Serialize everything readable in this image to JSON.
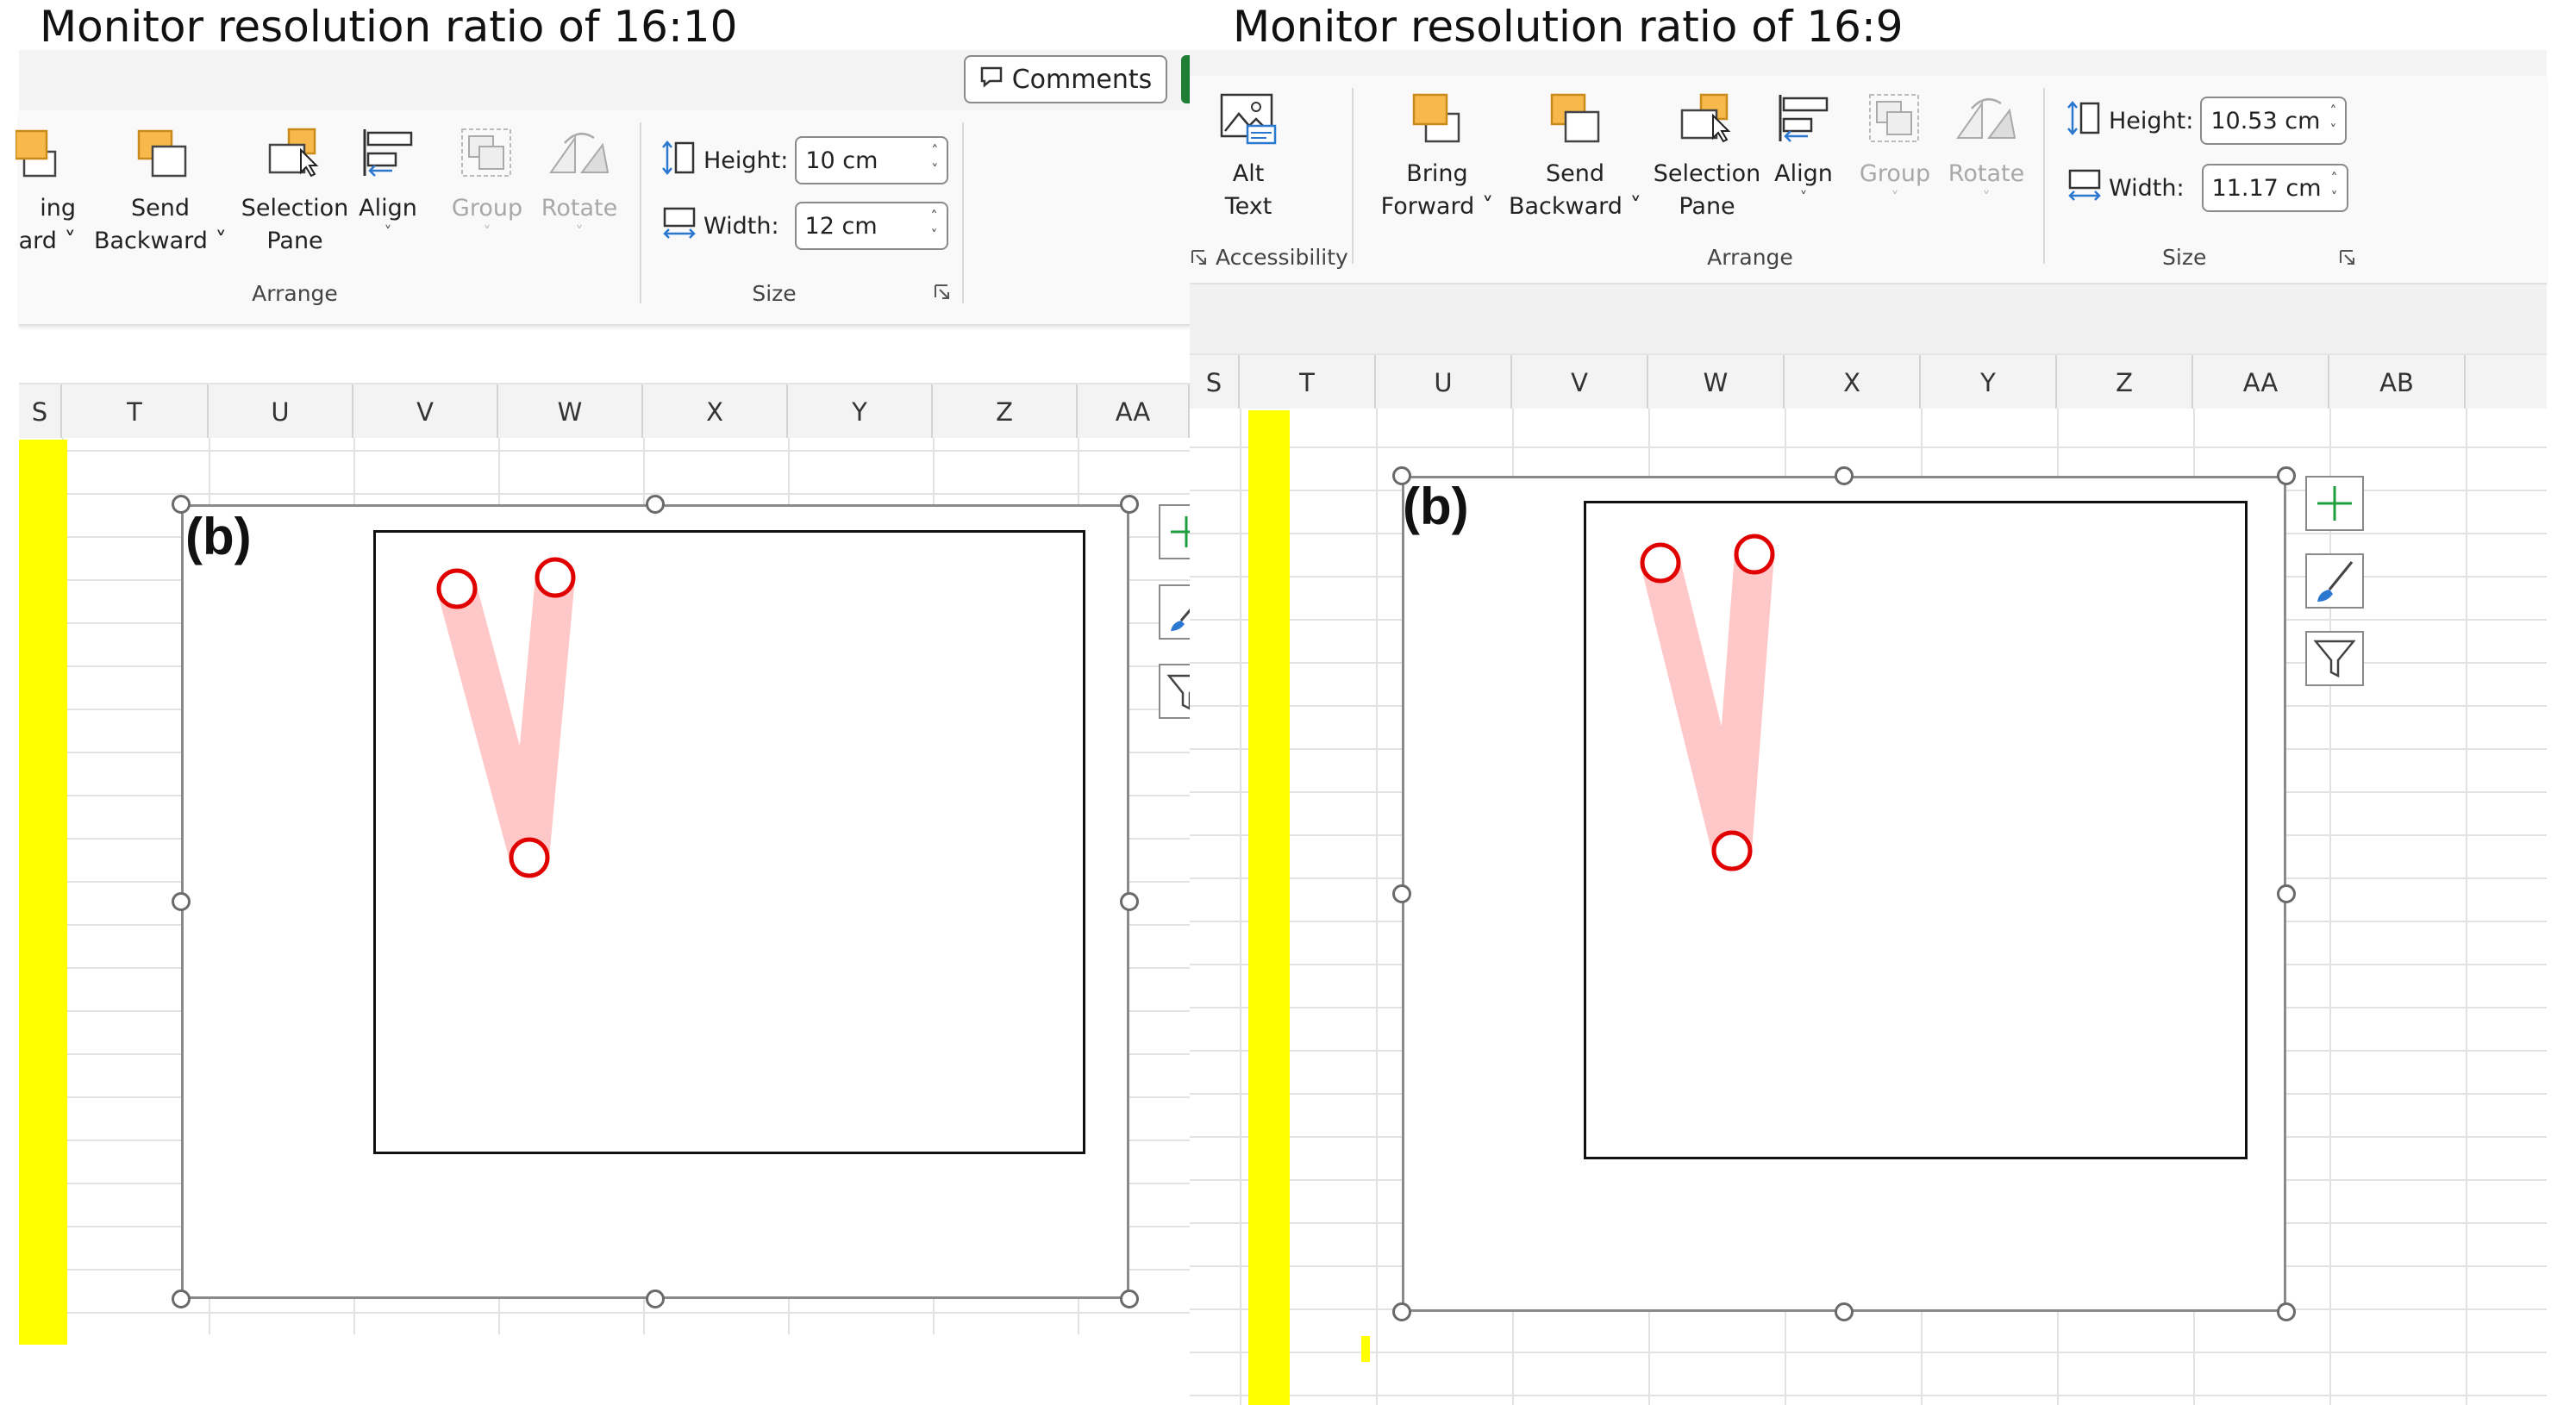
{
  "left": {
    "caption": "Monitor resolution ratio of 16:10",
    "comments_label": "Comments",
    "arrange": {
      "bring_forward": {
        "line1": "ing",
        "line2": "ard"
      },
      "send_backward": {
        "line1": "Send",
        "line2": "Backward"
      },
      "selection_pane": {
        "line1": "Selection",
        "line2": "Pane"
      },
      "align": "Align",
      "group": "Group",
      "rotate": "Rotate",
      "group_label": "Arrange"
    },
    "size": {
      "height_label": "Height:",
      "height_value": "10 cm",
      "width_label": "Width:",
      "width_value": "12 cm",
      "group_label": "Size"
    },
    "columns": [
      "S",
      "T",
      "U",
      "V",
      "W",
      "X",
      "Y",
      "Z",
      "AA"
    ],
    "panel_label": "(b)"
  },
  "right": {
    "caption": "Monitor resolution ratio of 16:9",
    "accessibility": {
      "alt_text": {
        "line1": "Alt",
        "line2": "Text"
      },
      "group_label": "Accessibility"
    },
    "arrange": {
      "bring_forward": {
        "line1": "Bring",
        "line2": "Forward"
      },
      "send_backward": {
        "line1": "Send",
        "line2": "Backward"
      },
      "selection_pane": {
        "line1": "Selection",
        "line2": "Pane"
      },
      "align": "Align",
      "group": "Group",
      "rotate": "Rotate",
      "group_label": "Arrange"
    },
    "size": {
      "height_label": "Height:",
      "height_value": "10.53 cm",
      "width_label": "Width:",
      "width_value": "11.17 cm",
      "group_label": "Size"
    },
    "columns": [
      "S",
      "T",
      "U",
      "V",
      "W",
      "X",
      "Y",
      "Z",
      "AA",
      "AB"
    ],
    "panel_label": "(b)"
  },
  "colors": {
    "highlight_column": "#ffff00",
    "marker_stroke": "#e00000",
    "band_fill": "#ffc8c8",
    "plus_icon": "#1e9e3c",
    "brush_icon": "#2b78d0"
  },
  "icons": [
    "comment-icon",
    "bring-forward-icon",
    "send-backward-icon",
    "selection-pane-icon",
    "align-icon",
    "group-icon",
    "rotate-icon",
    "height-icon",
    "width-icon",
    "alt-text-icon",
    "plus-icon",
    "brush-icon",
    "filter-icon",
    "dialog-launcher-icon"
  ]
}
